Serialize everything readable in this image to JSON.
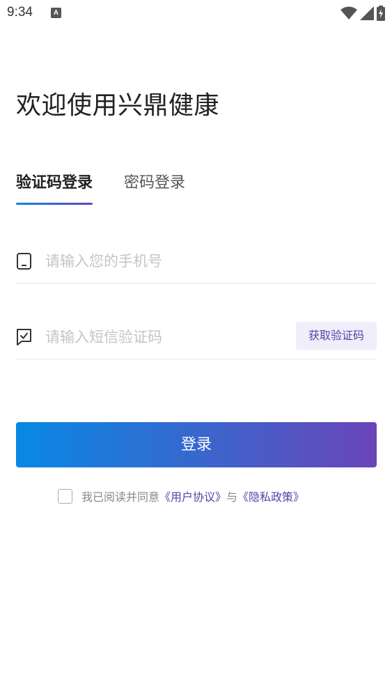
{
  "status_bar": {
    "time": "9:34",
    "notification_letter": "A"
  },
  "page_title": "欢迎使用兴鼎健康",
  "tabs": [
    {
      "label": "验证码登录",
      "active": true
    },
    {
      "label": "密码登录",
      "active": false
    }
  ],
  "phone_field": {
    "placeholder": "请输入您的手机号",
    "value": "",
    "icon": "phone-icon"
  },
  "code_field": {
    "placeholder": "请输入短信验证码",
    "value": "",
    "icon": "message-check-icon",
    "get_code_label": "获取验证码"
  },
  "login_button": {
    "label": "登录"
  },
  "agreement": {
    "checked": false,
    "prefix": "我已阅读并同意",
    "user_agreement_link": "《用户协议》",
    "joiner": "与",
    "privacy_policy_link": "《隐私政策》"
  },
  "colors": {
    "accent_start": "#0789e4",
    "accent_end": "#6a45b8",
    "link": "#5b3fa8",
    "get_code_bg": "#f0eefa"
  }
}
